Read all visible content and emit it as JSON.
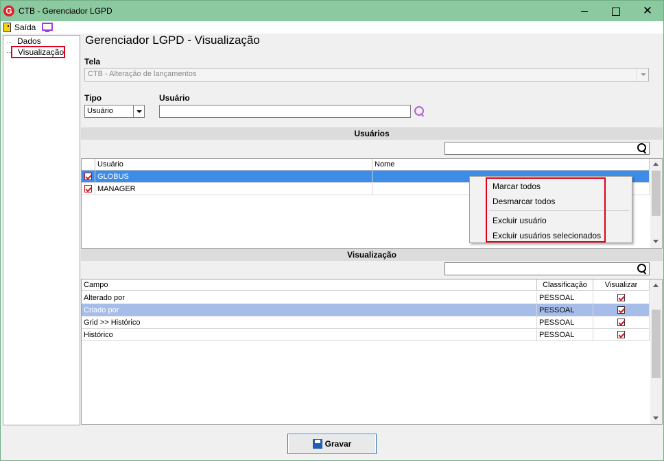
{
  "window": {
    "title": "CTB - Gerenciador LGPD",
    "app_icon": "G"
  },
  "menubar": {
    "exit_label": "Saída"
  },
  "tree": {
    "items": [
      {
        "label": "Dados"
      },
      {
        "label": "Visualização"
      }
    ]
  },
  "page": {
    "title": "Gerenciador LGPD - Visualização"
  },
  "form": {
    "tela_label": "Tela",
    "tela_value": "CTB - Alteração de lançamentos",
    "tipo_label": "Tipo",
    "tipo_value": "Usuário",
    "usuario_label": "Usuário",
    "usuario_value": ""
  },
  "users_section": {
    "title": "Usuários",
    "columns": [
      "Usuário",
      "Nome"
    ],
    "rows": [
      {
        "usuario": "GLOBUS",
        "nome": "",
        "checked": true
      },
      {
        "usuario": "MANAGER",
        "nome": "",
        "checked": true
      }
    ]
  },
  "context_menu": {
    "items": [
      "Marcar todos",
      "Desmarcar todos",
      "Excluir usuário",
      "Excluir usuários selecionados"
    ]
  },
  "view_section": {
    "title": "Visualização",
    "columns": [
      "Campo",
      "Classificação",
      "Visualizar"
    ],
    "rows": [
      {
        "campo": "Alterado por",
        "classificacao": "PESSOAL",
        "visualizar": true
      },
      {
        "campo": "Criado por",
        "classificacao": "PESSOAL",
        "visualizar": true
      },
      {
        "campo": "Grid >> Histórico",
        "classificacao": "PESSOAL",
        "visualizar": true
      },
      {
        "campo": "Histórico",
        "classificacao": "PESSOAL",
        "visualizar": true
      }
    ]
  },
  "footer": {
    "save_label": "Gravar"
  },
  "colors": {
    "titlebar": "#8cc8a0",
    "selection": "#3c8ce8",
    "highlight": "#e0001b"
  }
}
